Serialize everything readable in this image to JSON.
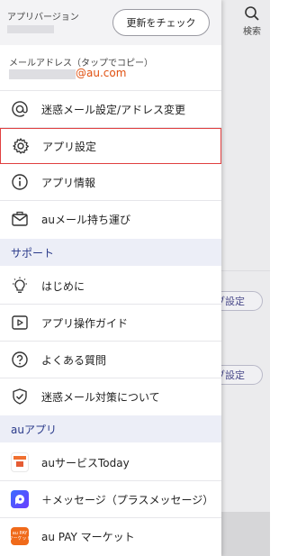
{
  "background": {
    "search_label": "検索",
    "pill1_label": "ブ設定",
    "pill2_label": "ブ設定"
  },
  "header": {
    "version_label": "アプリバージョン",
    "update_button": "更新をチェック",
    "mail_label": "メールアドレス（タップでコピー）",
    "mail_domain": "@au.com"
  },
  "menu": [
    {
      "label": "迷惑メール設定/アドレス変更",
      "icon": "at-sign-icon"
    },
    {
      "label": "アプリ設定",
      "icon": "gear-icon",
      "selected": true
    },
    {
      "label": "アプリ情報",
      "icon": "info-icon"
    },
    {
      "label": "auメール持ち運び",
      "icon": "envelope-icon"
    }
  ],
  "support": {
    "title": "サポート",
    "items": [
      {
        "label": "はじめに",
        "icon": "lightbulb-icon"
      },
      {
        "label": "アプリ操作ガイド",
        "icon": "play-icon"
      },
      {
        "label": "よくある質問",
        "icon": "question-icon"
      },
      {
        "label": "迷惑メール対策について",
        "icon": "shield-check-icon"
      }
    ]
  },
  "au_apps": {
    "title": "auアプリ",
    "items": [
      {
        "label": "auサービスToday",
        "icon": "au-today-app-icon"
      },
      {
        "label": "＋メッセージ（プラスメッセージ）",
        "icon": "plus-message-app-icon"
      },
      {
        "label": "au PAY マーケット",
        "icon": "au-pay-market-app-icon",
        "icon_text": "au PAY\nマーケット"
      }
    ]
  },
  "colors": {
    "accent_red": "#e04040",
    "section_bg": "#eceef7",
    "section_text": "#2a3a8a",
    "domain_orange": "#e05010"
  }
}
